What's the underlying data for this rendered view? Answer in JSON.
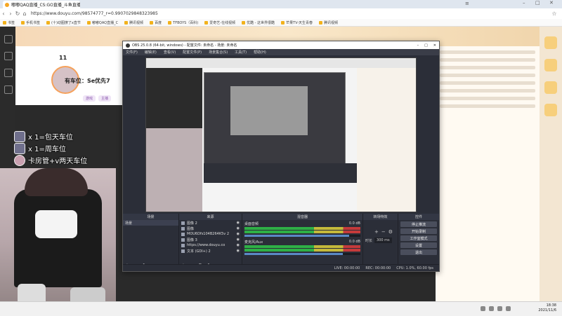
{
  "browser": {
    "tab_title": "嘟嘟QAQ直播_CS:GO直播_斗鱼直播",
    "url": "https://www.douyu.com/98574777_r=0.9907029848323985",
    "bookmarks": [
      "书签",
      "手机书签",
      "(十)动图撩了x直节",
      "嘟嘟QAQ直播_C",
      "腾讯视频",
      "百度",
      "TFBOYS（百科)",
      "爱奇艺-在线视频",
      "优酷 - 这世界很酷",
      "芒果TV-天生青春",
      "腾讯视频"
    ]
  },
  "page": {
    "room_title": "有车位：Se优先7",
    "tags": [
      "游戏",
      "主播"
    ],
    "level_number": "11"
  },
  "overlay": {
    "lines": [
      "x 1=包天车位",
      "x 1=周车位",
      "卡房管+v两天车位"
    ]
  },
  "obs": {
    "title": "OBS 25.0.8 (64-bit, windows) - 配置文件: 未命名 - 场景: 未命名",
    "menu": [
      "文件(F)",
      "编辑(E)",
      "查看(V)",
      "配置文件(P)",
      "场景集合(S)",
      "工具(T)",
      "帮助(H)"
    ],
    "docks": {
      "scenes": "场景",
      "sources": "来源",
      "mixer": "混音器",
      "transitions": "转场特效",
      "controls": "控件"
    },
    "scene_list": [
      "场景"
    ],
    "sources_list": [
      "图像 2",
      "图像",
      "MOU6Dfs104B264K5v 2",
      "图像 3",
      "https://www.douyu.co",
      "文本 (GDI+) 2"
    ],
    "mixer_channels": [
      {
        "name": "桌面音频",
        "level": "0.0 dB",
        "volume": 0.9
      },
      {
        "name": "麦克风/Aux",
        "level": "0.0 dB",
        "volume": 0.85
      }
    ],
    "transition_duration": "300 ms",
    "transition_label": "时长",
    "control_buttons": [
      "停止推流",
      "开始录制",
      "工作室模式",
      "设置",
      "退出"
    ],
    "status": {
      "live": "LIVE: 00:00:00",
      "rec": "REC: 00:00:00",
      "cpu": "CPU: 1.0%, 60.00 fps"
    }
  },
  "taskbar": {
    "time": "18:38",
    "date": "2021/11/6"
  },
  "colors": {
    "accent": "#ff7a28",
    "obs_bg": "#2b2e38"
  }
}
